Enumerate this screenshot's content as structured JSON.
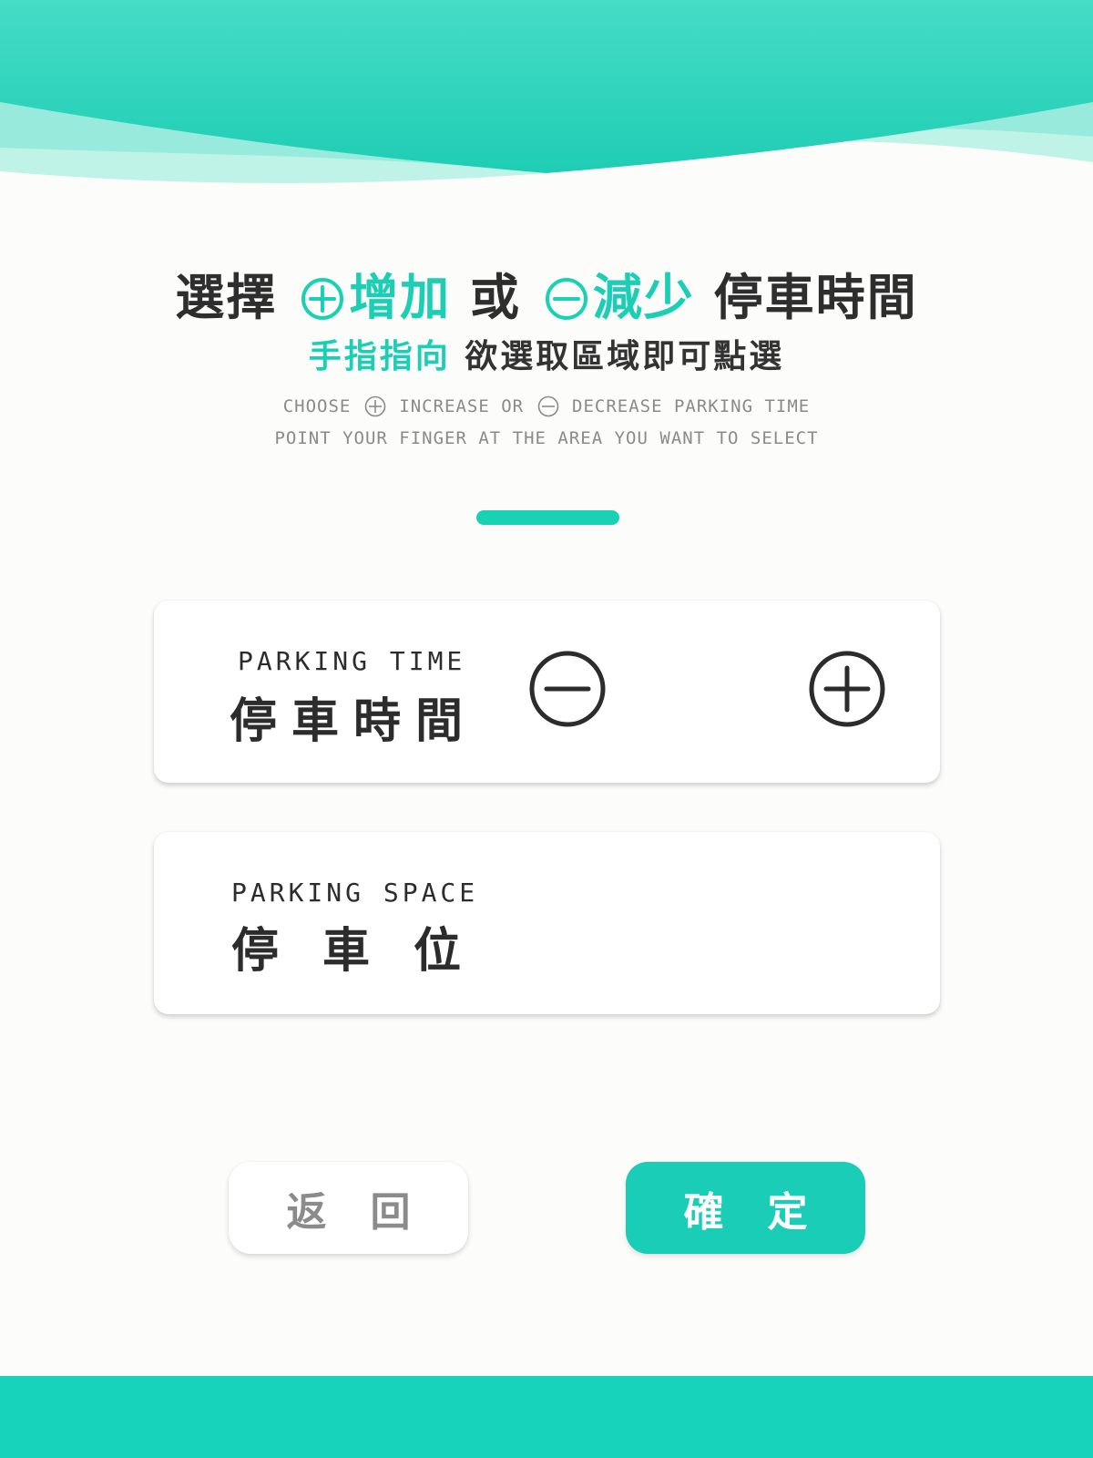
{
  "header": {
    "title_prefix": "選擇",
    "increase": "增加",
    "connector": "或",
    "decrease": "減少",
    "title_suffix": "停車時間",
    "plus_icon": "circle-plus-icon",
    "minus_icon": "circle-minus-icon"
  },
  "subheader": {
    "accent": "手指指向",
    "rest": "欲選取區域即可點選"
  },
  "english": {
    "line1_choose": "CHOOSE",
    "line1_increase": "INCREASE OR",
    "line1_decrease": "DECREASE PARKING TIME",
    "line2": "POINT YOUR FINGER AT THE AREA YOU WANT TO SELECT"
  },
  "parking_time_card": {
    "label_en": "PARKING TIME",
    "label_zh": "停車時間",
    "minus_icon": "circle-minus-icon",
    "plus_icon": "circle-plus-icon"
  },
  "parking_space_card": {
    "label_en": "PARKING SPACE",
    "label_zh": "停車位"
  },
  "buttons": {
    "back": "返回",
    "confirm": "確定"
  },
  "colors": {
    "accent": "#19d2b4",
    "text_dark": "#2e2e2e",
    "text_gray": "#8a8a8a",
    "background": "#fcfcfb"
  }
}
